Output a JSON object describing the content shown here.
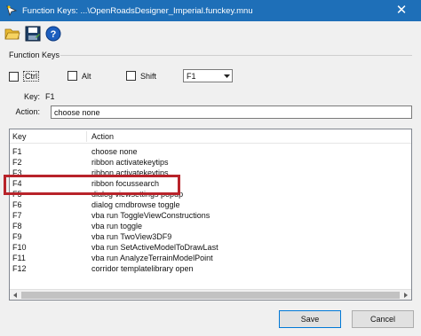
{
  "window": {
    "title": "Function Keys: ...\\OpenRoadsDesigner_Imperial.funckey.mnu",
    "close_label": "✕"
  },
  "toolbar": {
    "icons": [
      "open-folder-icon",
      "save-disk-icon",
      "help-icon"
    ]
  },
  "function_keys": {
    "group_label": "Function Keys",
    "ctrl_label": "Ctrl",
    "alt_label": "Alt",
    "shift_label": "Shift",
    "key_select_value": "F1",
    "key_label": "Key:",
    "key_value": "F1",
    "action_label": "Action:",
    "action_value": "choose none"
  },
  "list": {
    "columns": [
      "Key",
      "Action"
    ],
    "rows": [
      {
        "key": "F1",
        "action": "choose none"
      },
      {
        "key": "F2",
        "action": "ribbon activatekeytips"
      },
      {
        "key": "F3",
        "action": "ribbon activatekeytips"
      },
      {
        "key": "F4",
        "action": "ribbon focussearch"
      },
      {
        "key": "F5",
        "action": "dialog viewsettings popup"
      },
      {
        "key": "F6",
        "action": "dialog cmdbrowse toggle"
      },
      {
        "key": "F7",
        "action": "vba run ToggleViewConstructions"
      },
      {
        "key": "F8",
        "action": "vba run toggle"
      },
      {
        "key": "F9",
        "action": "vba run TwoView3DF9"
      },
      {
        "key": "F10",
        "action": "vba run SetActiveModelToDrawLast"
      },
      {
        "key": "F11",
        "action": "vba run AnalyzeTerrainModelPoint"
      },
      {
        "key": "F12",
        "action": "corridor templatelibrary open"
      }
    ]
  },
  "buttons": {
    "save_label": "Save",
    "cancel_label": "Cancel"
  },
  "colors": {
    "titlebar": "#1e6fb8",
    "highlight_box": "#b8232a"
  }
}
